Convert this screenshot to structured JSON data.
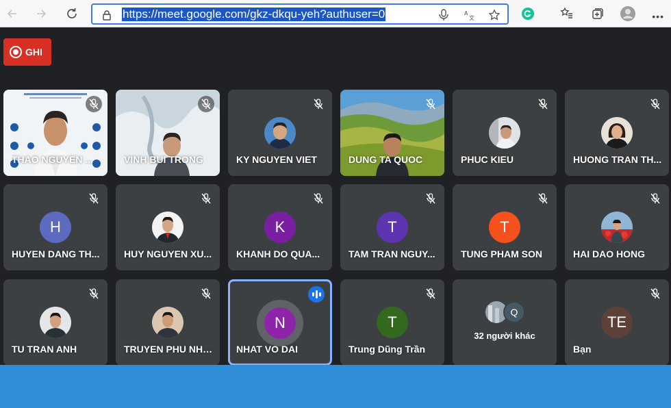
{
  "browser": {
    "url": "https://meet.google.com/gkz-dkqu-yeh?authuser=0"
  },
  "meet": {
    "record_label": "GHI",
    "others_label": "32 người khác",
    "others_initial": "Q",
    "participants": [
      {
        "name": "THAO NGUYEN ...",
        "initial": "",
        "muted": true
      },
      {
        "name": "VINH BUI TRONG",
        "initial": "",
        "muted": true
      },
      {
        "name": "KY NGUYEN VIET",
        "initial": "",
        "muted": true
      },
      {
        "name": "DUNG TA QUOC",
        "initial": "",
        "muted": true
      },
      {
        "name": "PHUC KIEU",
        "initial": "",
        "muted": true
      },
      {
        "name": "HUONG TRAN TH...",
        "initial": "",
        "muted": true
      },
      {
        "name": "HUYEN DANG TH...",
        "initial": "H",
        "color": "#5c6bc0",
        "muted": true
      },
      {
        "name": "HUY NGUYEN XU...",
        "initial": "",
        "muted": true
      },
      {
        "name": "KHANH DO QUA...",
        "initial": "K",
        "color": "#7b1fa2",
        "muted": true
      },
      {
        "name": "TAM TRAN NGUY...",
        "initial": "T",
        "color": "#5e35b1",
        "muted": true
      },
      {
        "name": "TUNG PHAM SON",
        "initial": "T",
        "color": "#f4511e",
        "muted": true
      },
      {
        "name": "HAI DAO HONG",
        "initial": "",
        "muted": true
      },
      {
        "name": "TU TRAN ANH",
        "initial": "",
        "muted": true
      },
      {
        "name": "TRUYEN PHU NHAT",
        "initial": "",
        "muted": true
      },
      {
        "name": "NHAT VO DAI",
        "initial": "N",
        "color": "#8e24aa",
        "muted": false,
        "speaking": true
      },
      {
        "name": "Trung Dũng Trần",
        "initial": "T",
        "color": "#33691e",
        "muted": true
      },
      {
        "name": "Bạn",
        "initial": "TE",
        "color": "#5d4037",
        "muted": true
      }
    ]
  }
}
